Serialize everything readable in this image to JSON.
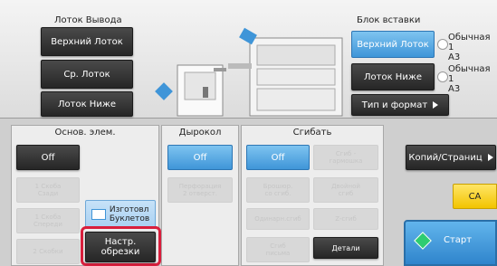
{
  "output_tray": {
    "title": "Лоток Вывода",
    "items": [
      "Верхний Лоток",
      "Ср. Лоток",
      "Лоток Ниже"
    ]
  },
  "inserter": {
    "title": "Блок вставки",
    "upper": "Верхний Лоток",
    "lower": "Лоток Ниже",
    "paper1": "Обычная 1",
    "size1": "A3",
    "paper2": "Обычная 1",
    "size2": "A3",
    "type_format": "Тип и формат"
  },
  "basic": {
    "title": "Основ. элем.",
    "off": "Off",
    "opt1": "1 Скоба\nСзади",
    "opt2": "1 Скоба\nСпереди",
    "opt3": "2 Скобки",
    "booklet": "Изготовл\nБуклетов",
    "trim": "Настр.\nобрезки"
  },
  "punch": {
    "title": "Дырокол",
    "off": "Off",
    "opt1": "Перфорация\n2 отверст."
  },
  "fold": {
    "title": "Сгибать",
    "off": "Off",
    "opt1": "Сгиб -\nгармошка",
    "opt2": "Брошюр.\nсо сгиб.",
    "opt3": "Двойной\nсгиб",
    "opt4": "Одинарн.сгиб",
    "opt5": "Z-сгиб",
    "opt6": "Сгиб\nписьма",
    "details": "Детали"
  },
  "right": {
    "copies": "Копий/Страниц",
    "ca": "CA",
    "start": "Старт"
  },
  "colors": {
    "blue": "#3f95d8",
    "highlight": "#d81e3c"
  }
}
